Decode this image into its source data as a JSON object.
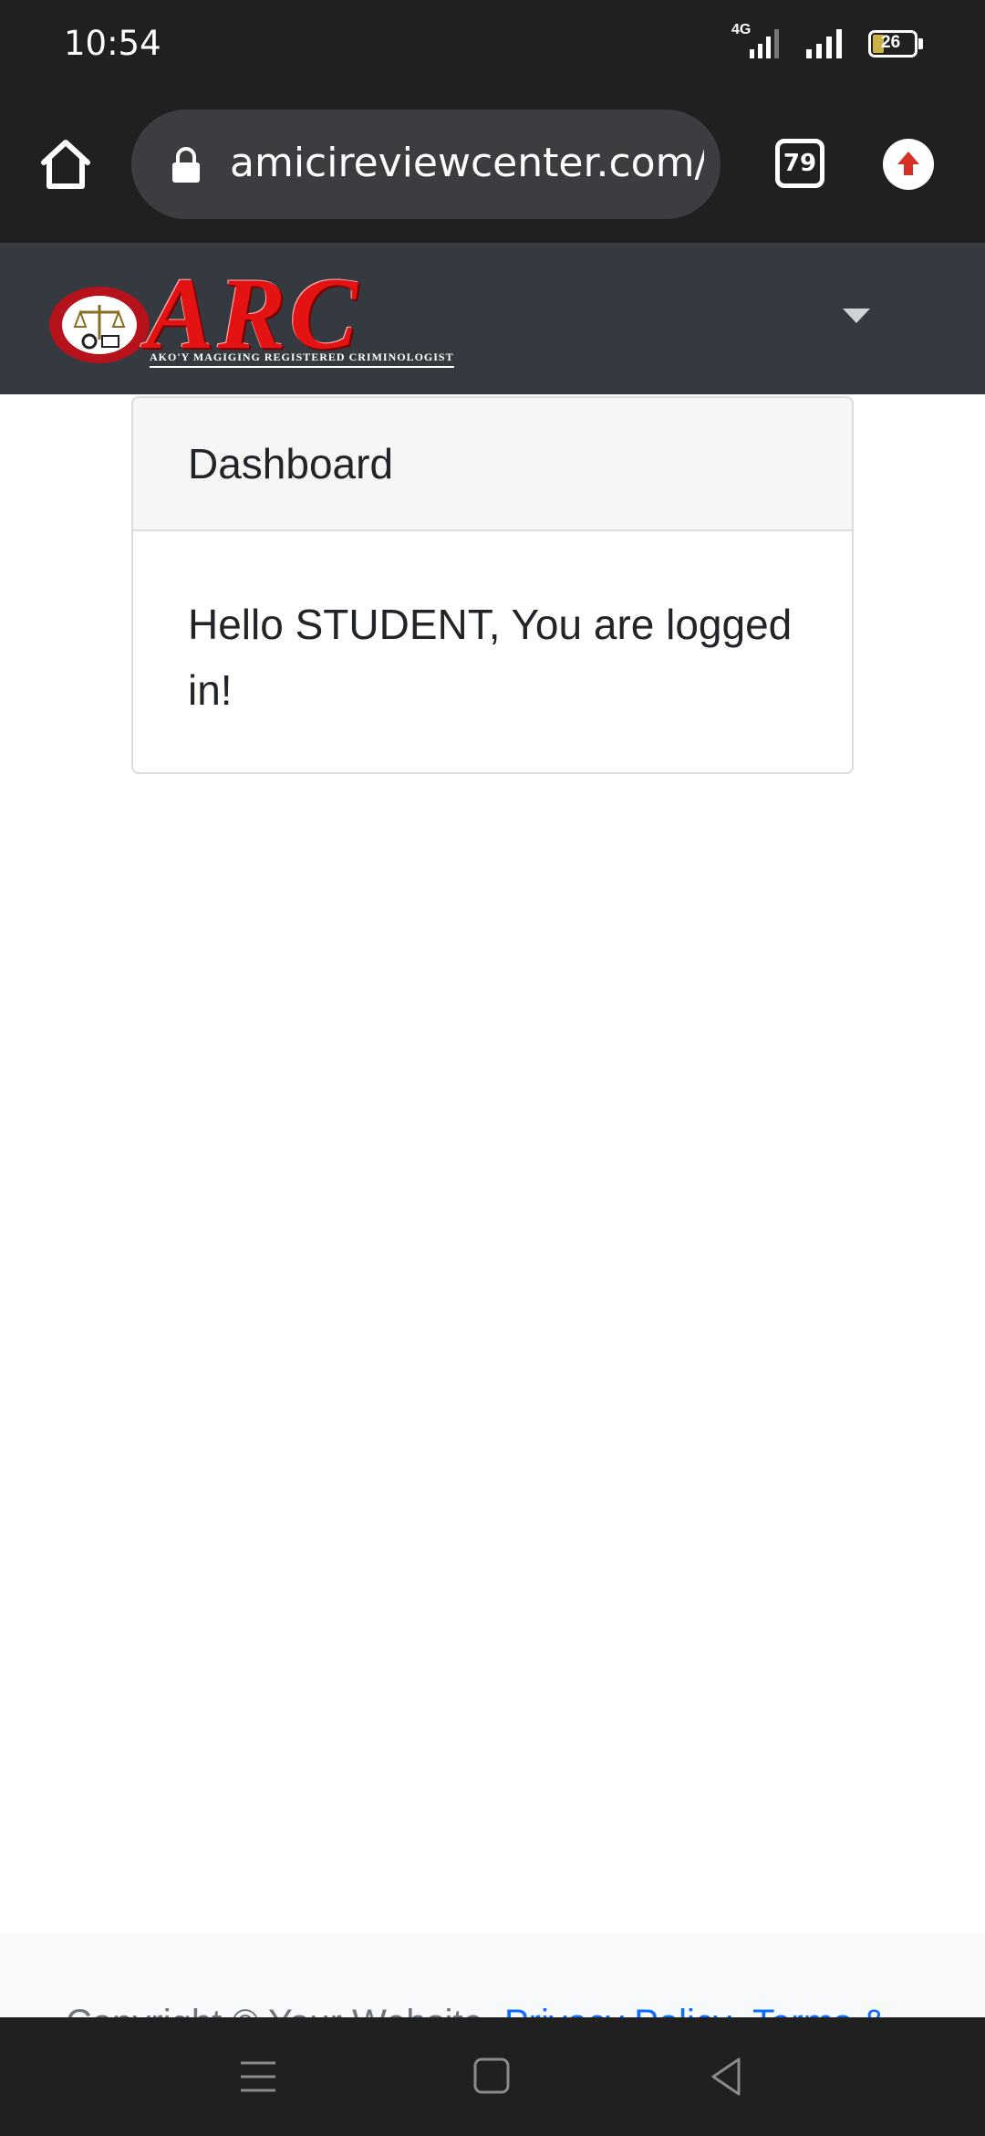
{
  "status_bar": {
    "time": "10:54",
    "network": "4G",
    "battery": "26"
  },
  "browser": {
    "url": "amicireviewcenter.com/student",
    "tab_count": "79"
  },
  "navbar": {
    "brand_text": "ARC",
    "tagline": "AKO'Y MAGIGING REGISTERED CRIMINOLOGIST"
  },
  "card": {
    "header": "Dashboard",
    "message": "Hello STUDENT, You are logged in!"
  },
  "footer": {
    "copyright": "Copyright © Your Website",
    "privacy": "Privacy Policy",
    "terms": "Terms &"
  },
  "colors": {
    "navbar_bg": "#343a40",
    "brand_red": "#e31313",
    "link_blue": "#0d6efd"
  }
}
